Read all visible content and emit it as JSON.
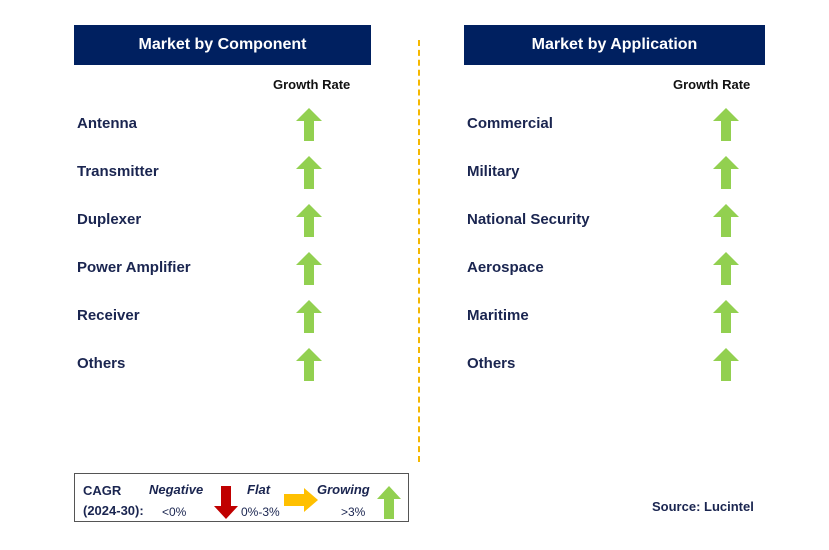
{
  "left": {
    "title": "Market by Component",
    "growth_label": "Growth Rate",
    "items": [
      "Antenna",
      "Transmitter",
      "Duplexer",
      "Power Amplifier",
      "Receiver",
      "Others"
    ]
  },
  "right": {
    "title": "Market by Application",
    "growth_label": "Growth Rate",
    "items": [
      "Commercial",
      "Military",
      "National Security",
      "Aerospace",
      "Maritime",
      "Others"
    ]
  },
  "growth_trend": "up",
  "arrow_color": "#92d050",
  "legend": {
    "cagr": "CAGR",
    "period": "(2024-30):",
    "negative": "Negative",
    "negative_range": "<0%",
    "flat": "Flat",
    "flat_range": "0%-3%",
    "growing": "Growing",
    "growing_range": ">3%",
    "colors": {
      "negative": "#c00000",
      "flat": "#ffc000",
      "growing": "#92d050"
    }
  },
  "source": "Source: Lucintel"
}
